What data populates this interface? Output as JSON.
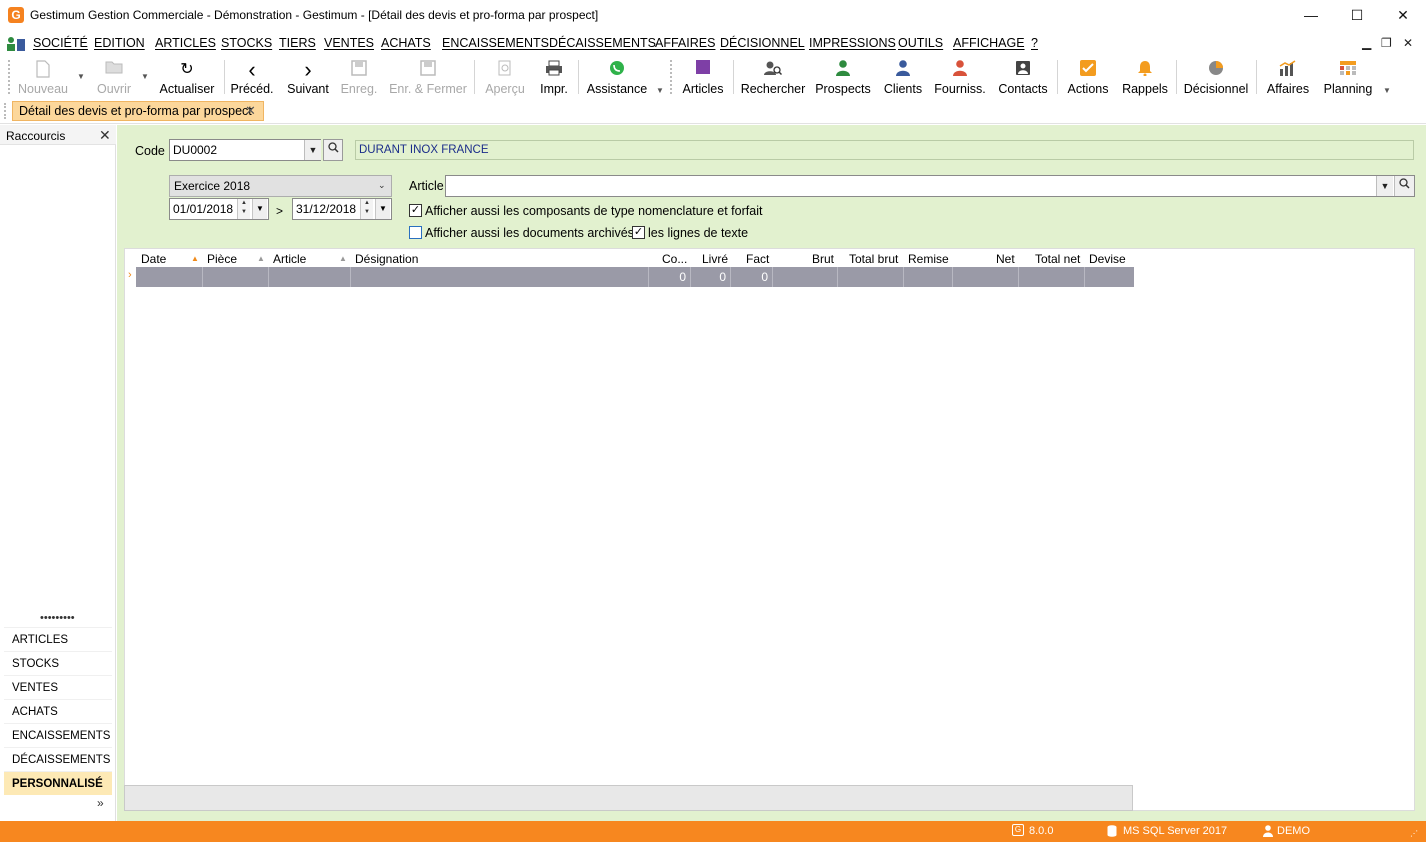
{
  "window": {
    "title": "Gestimum Gestion Commerciale - Démonstration - Gestimum - [Détail des devis et pro-forma par prospect]",
    "logo_letter": "G",
    "minimize_glyph": "—",
    "maximize_glyph": "☐",
    "close_glyph": "✕"
  },
  "menu": {
    "items": [
      "SOCIÉTÉ",
      "EDITION",
      "ARTICLES",
      "STOCKS",
      "TIERS",
      "VENTES",
      "ACHATS",
      "ENCAISSEMENTS",
      "DÉCAISSEMENTS",
      "AFFAIRES",
      "DÉCISIONNEL",
      "IMPRESSIONS",
      "OUTILS",
      "AFFICHAGE",
      "?"
    ],
    "controls": [
      "▁",
      "❐",
      "✕"
    ]
  },
  "toolbar": {
    "buttons": [
      {
        "label": "Nouveau",
        "icon": "new-document-icon",
        "glyph": "🗋",
        "enabled": false
      },
      {
        "label": "Ouvrir",
        "icon": "open-folder-icon",
        "glyph": "📂",
        "enabled": false
      },
      {
        "label": "Actualiser",
        "icon": "refresh-icon",
        "glyph": "↻",
        "enabled": true
      },
      {
        "label": "Précéd.",
        "icon": "chevron-left-icon",
        "glyph": "‹",
        "enabled": true
      },
      {
        "label": "Suivant",
        "icon": "chevron-right-icon",
        "glyph": "›",
        "enabled": true
      },
      {
        "label": "Enreg.",
        "icon": "save-icon",
        "glyph": "💾",
        "enabled": false
      },
      {
        "label": "Enr. & Fermer",
        "icon": "save-close-icon",
        "glyph": "💾",
        "enabled": false
      },
      {
        "label": "Aperçu",
        "icon": "preview-icon",
        "glyph": "🔍",
        "enabled": false
      },
      {
        "label": "Impr.",
        "icon": "print-icon",
        "glyph": "🖶",
        "enabled": true
      },
      {
        "label": "Assistance",
        "icon": "whatsapp-icon",
        "glyph": "✆",
        "enabled": true
      },
      {
        "label": "Articles",
        "icon": "articles-icon",
        "glyph": "■",
        "enabled": true
      },
      {
        "label": "Rechercher",
        "icon": "search-person-icon",
        "glyph": "👤",
        "enabled": true
      },
      {
        "label": "Prospects",
        "icon": "prospect-person-icon",
        "glyph": "👤",
        "enabled": true
      },
      {
        "label": "Clients",
        "icon": "client-person-icon",
        "glyph": "👤",
        "enabled": true
      },
      {
        "label": "Fourniss.",
        "icon": "supplier-person-icon",
        "glyph": "👤",
        "enabled": true
      },
      {
        "label": "Contacts",
        "icon": "contacts-icon",
        "glyph": "▣",
        "enabled": true
      },
      {
        "label": "Actions",
        "icon": "actions-check-icon",
        "glyph": "✔",
        "enabled": true
      },
      {
        "label": "Rappels",
        "icon": "bell-icon",
        "glyph": "🔔",
        "enabled": true
      },
      {
        "label": "Décisionnel",
        "icon": "pie-chart-icon",
        "glyph": "◕",
        "enabled": true
      },
      {
        "label": "Affaires",
        "icon": "bar-chart-icon",
        "glyph": "▟",
        "enabled": true
      },
      {
        "label": "Planning",
        "icon": "planning-icon",
        "glyph": "▦",
        "enabled": true
      }
    ],
    "colors": {
      "articles": "#7e3fa6",
      "prospects": "#2e8b3f",
      "clients": "#3a5a9c",
      "suppliers": "#d8523a",
      "actions": "#f39c1f",
      "bell": "#f39c1f",
      "whatsapp": "#2fb24a"
    }
  },
  "tab": {
    "label": "Détail des devis et pro-forma par prospect",
    "close_glyph": "✕"
  },
  "left_panel": {
    "title": "Raccourcis",
    "close_glyph": "✕",
    "dots": "•••••••••",
    "nav_items": [
      "ARTICLES",
      "STOCKS",
      "VENTES",
      "ACHATS",
      "ENCAISSEMENTS",
      "DÉCAISSEMENTS",
      "PERSONNALISÉ"
    ],
    "active_item": "PERSONNALISÉ",
    "more_glyph": "»"
  },
  "form": {
    "code_label": "Code",
    "code_value": "DU0002",
    "prospect_name": "DURANT INOX FRANCE",
    "period_value": "Exercice 2018",
    "date_from": "01/01/2018",
    "date_to": "31/12/2018",
    "date_separator": ">",
    "article_label": "Article",
    "article_value": "",
    "checkbox_components_label": "Afficher aussi les composants de type nomenclature et forfait",
    "checkbox_components_checked": true,
    "checkbox_archived_label": "Afficher aussi les documents archivés",
    "checkbox_archived_checked": false,
    "checkbox_text_lines_label": "les lignes de texte",
    "checkbox_text_lines_checked": true,
    "check_glyph": "✓"
  },
  "grid": {
    "columns": [
      "Date",
      "Pièce",
      "Article",
      "Désignation",
      "Co...",
      "Livré",
      "Fact",
      "Brut",
      "Total brut",
      "Remise",
      "Net",
      "Total net",
      "Devise"
    ],
    "row_values": {
      "co": "0",
      "livre": "0",
      "fact": "0"
    },
    "row_marker": "›",
    "sort_glyph": "▲"
  },
  "status": {
    "version": "8.0.0",
    "database": "MS SQL Server 2017",
    "user": "DEMO"
  },
  "colors": {
    "accent": "#f7871f",
    "main_bg": "#e2f1cf",
    "tab_bg": "#fcd79b",
    "row_bg": "#9a9aa7"
  }
}
